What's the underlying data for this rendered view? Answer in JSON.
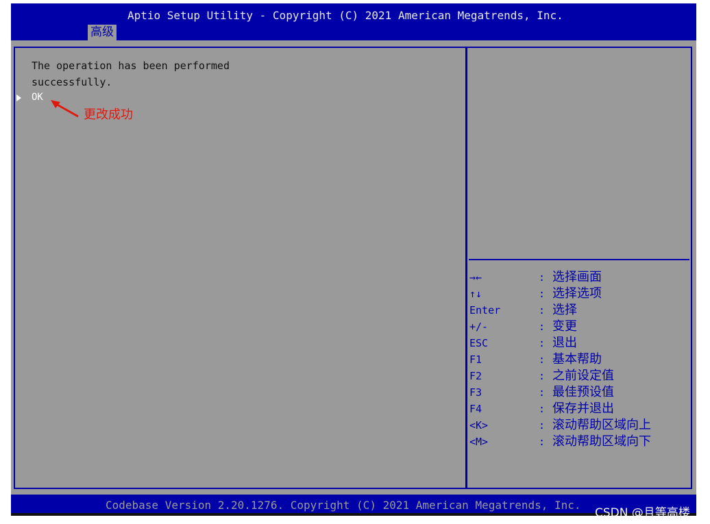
{
  "header": {
    "title": "Aptio Setup Utility - Copyright (C) 2021 American Megatrends, Inc.",
    "active_tab": "高级"
  },
  "message": {
    "line1": "The operation has been performed",
    "line2": "successfully.",
    "ok_label": "OK"
  },
  "annotation": {
    "label": "更改成功",
    "color": "#e0190e"
  },
  "help": {
    "items": [
      {
        "key": "→←",
        "icon": "arrow-left-right-icon",
        "desc": "选择画面"
      },
      {
        "key": "↑↓",
        "icon": "arrow-up-down-icon",
        "desc": "选择选项"
      },
      {
        "key": "Enter",
        "desc": "选择"
      },
      {
        "key": "+/-",
        "desc": "变更"
      },
      {
        "key": "ESC",
        "desc": "退出"
      },
      {
        "key": "F1",
        "desc": "基本帮助"
      },
      {
        "key": "F2",
        "desc": "之前设定值"
      },
      {
        "key": "F3",
        "desc": "最佳预设值"
      },
      {
        "key": "F4",
        "desc": "保存并退出"
      },
      {
        "key": "<K>",
        "desc": "滚动帮助区域向上"
      },
      {
        "key": "<M>",
        "desc": "滚动帮助区域向下"
      }
    ]
  },
  "footer": {
    "text": "Codebase Version 2.20.1276. Copyright (C) 2021 American Megatrends, Inc."
  },
  "watermark": "CSDN @且等高楼",
  "colors": {
    "header_blue": "#0000a8",
    "panel_gray": "#9a9a9a",
    "annotation_red": "#e0190e"
  }
}
